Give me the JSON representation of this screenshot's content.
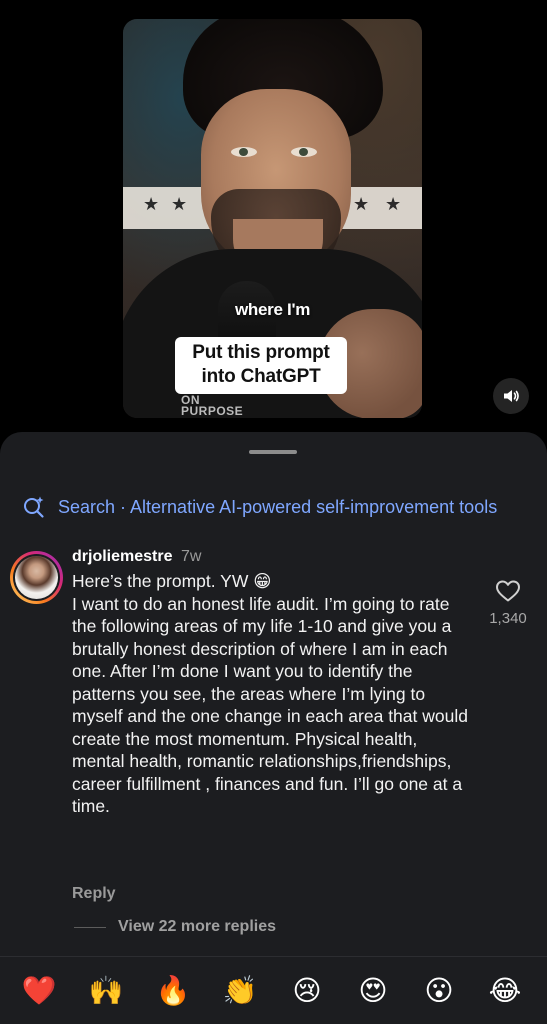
{
  "video": {
    "caption_line": "where I'm",
    "caption_box_line1": "Put this prompt",
    "caption_box_line2": "into ChatGPT",
    "brand_line1": "ON",
    "brand_line2": "PURPOSE",
    "sound_icon": "speaker-icon"
  },
  "search": {
    "icon": "sparkle-search-icon",
    "text": "Search · Alternative AI-powered self-improvement tools"
  },
  "comment": {
    "username": "drjoliemestre",
    "time": "7w",
    "first_line": "Here’s the prompt. YW 😁",
    "body": "I want to do an honest life audit. I’m going to rate the following areas of my life 1-10 and give you a brutally honest description of where I am in each one. After I’m done I want you to identify the patterns you see, the areas where I’m lying to myself and the one change in each area that would create the most momentum. Physical health, mental health, romantic relationships,friendships, career fulfillment , finances and fun. I’ll go one at a time.",
    "like_icon": "heart-outline-icon",
    "like_count": "1,340",
    "reply_label": "Reply",
    "more_replies_label": "View 22 more replies"
  },
  "reactions": [
    "❤️",
    "🙌",
    "🔥",
    "👏",
    "😢",
    "😍",
    "😮",
    "😂"
  ],
  "colors": {
    "background": "#000000",
    "sheet": "#1c1d20",
    "search_accent": "#7fa7ff",
    "muted_text": "#9a9a9a"
  }
}
